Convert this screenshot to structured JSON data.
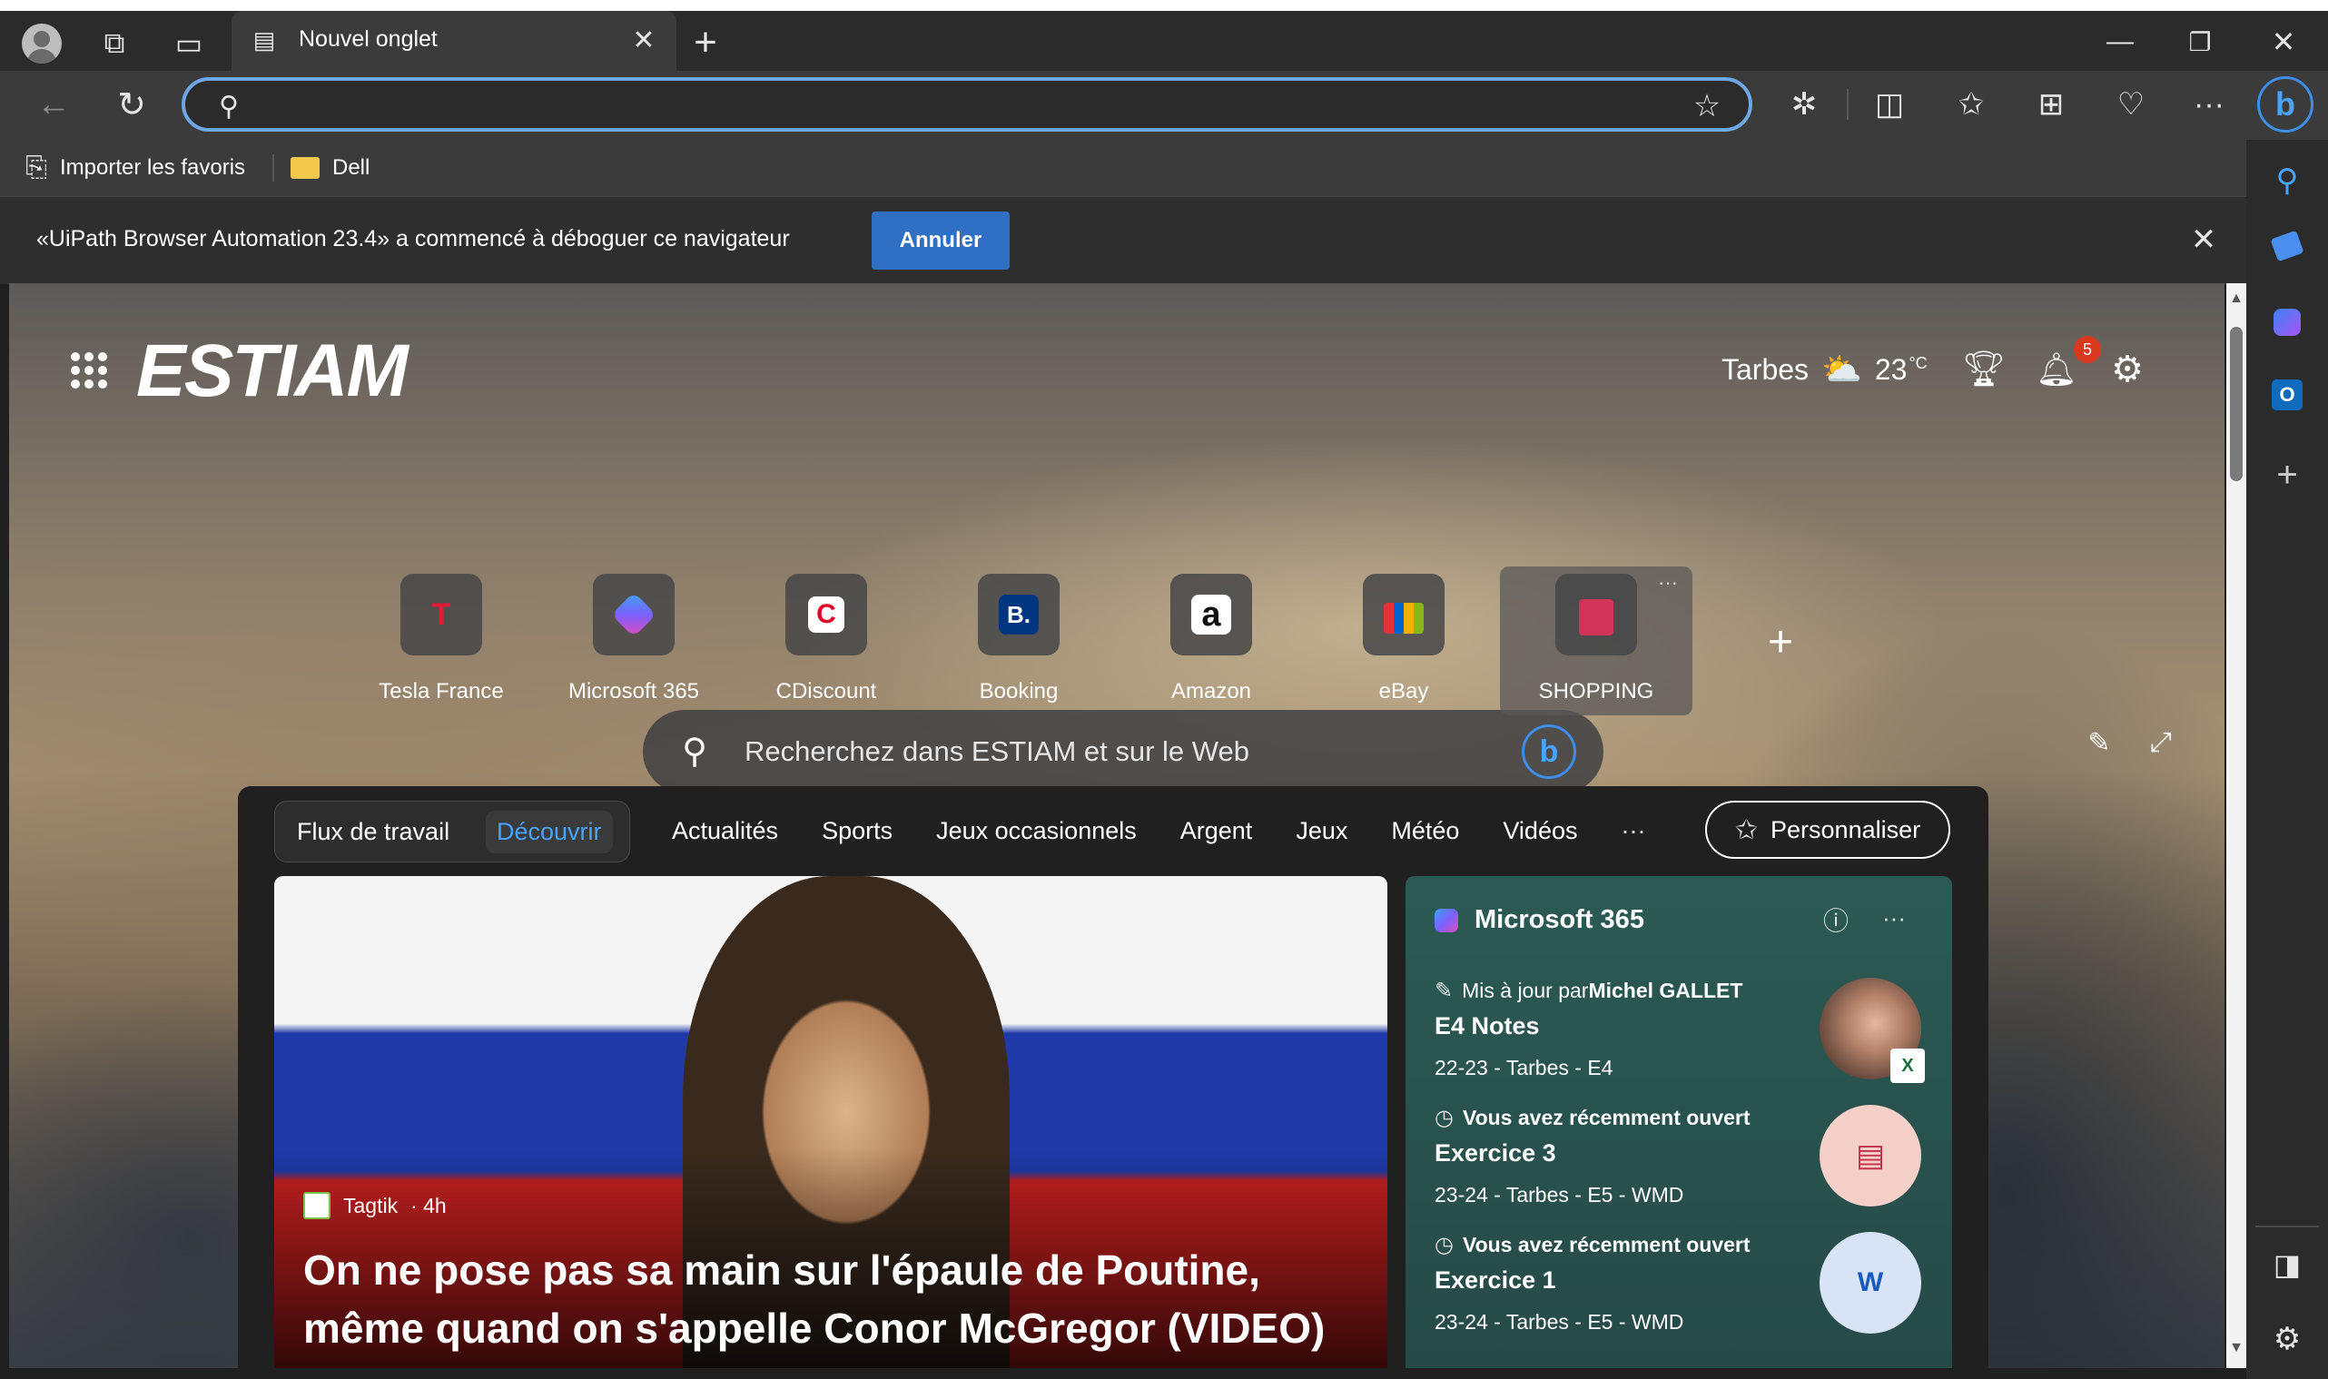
{
  "browser": {
    "tab_title": "Nouvel onglet",
    "favorites": [
      {
        "label": "Importer les favoris",
        "icon": "import-favorites-icon"
      },
      {
        "label": "Dell",
        "icon": "folder-icon"
      }
    ],
    "infobar_text": "«UiPath Browser Automation 23.4» a commencé à déboguer ce navigateur",
    "infobar_button": "Annuler"
  },
  "newtab": {
    "logo": "ESTIAM",
    "weather": {
      "city": "Tarbes",
      "temp": "23",
      "unit": "°C"
    },
    "notification_count": "5",
    "search_placeholder": "Recherchez dans ESTIAM et sur le Web",
    "quicklinks": [
      {
        "label": "Tesla France",
        "glyph": "T",
        "color": "#e31937"
      },
      {
        "label": "Microsoft 365",
        "glyph": "◈",
        "color": "#7b61ff"
      },
      {
        "label": "CDiscount",
        "glyph": "C",
        "color": "#e4002b"
      },
      {
        "label": "Booking",
        "glyph": "B.",
        "color": "#003580"
      },
      {
        "label": "Amazon",
        "glyph": "a",
        "color": "#ffffff"
      },
      {
        "label": "eBay",
        "glyph": "▮",
        "color": "#e53238"
      },
      {
        "label": "SHOPPING",
        "glyph": "🛍",
        "color": "#d0345a"
      }
    ]
  },
  "feed": {
    "tabs_group": [
      "Flux de travail",
      "Découvrir"
    ],
    "tabs": [
      "Actualités",
      "Sports",
      "Jeux occasionnels",
      "Argent",
      "Jeux",
      "Météo",
      "Vidéos",
      "···"
    ],
    "personalize": "Personnaliser",
    "news": {
      "source": "Tagtik",
      "age": "· 4h",
      "headline": "On ne pose pas sa main sur l'épaule de Poutine, même quand on s'appelle Conor McGregor (VIDEO)"
    },
    "m365": {
      "title": "Microsoft 365",
      "items": [
        {
          "prefix": "Mis à jour par ",
          "who": "Michel GALLET",
          "name": "E4 Notes",
          "path": "22-23 - Tarbes - E4",
          "thumb": "excel"
        },
        {
          "prefix": "",
          "who": "Vous avez récemment ouvert",
          "name": "Exercice 3",
          "path": "23-24 - Tarbes - E5 - WMD",
          "thumb": "pdf"
        },
        {
          "prefix": "",
          "who": "Vous avez récemment ouvert",
          "name": "Exercice 1",
          "path": "23-24 - Tarbes - E5 - WMD",
          "thumb": "word"
        }
      ]
    }
  }
}
